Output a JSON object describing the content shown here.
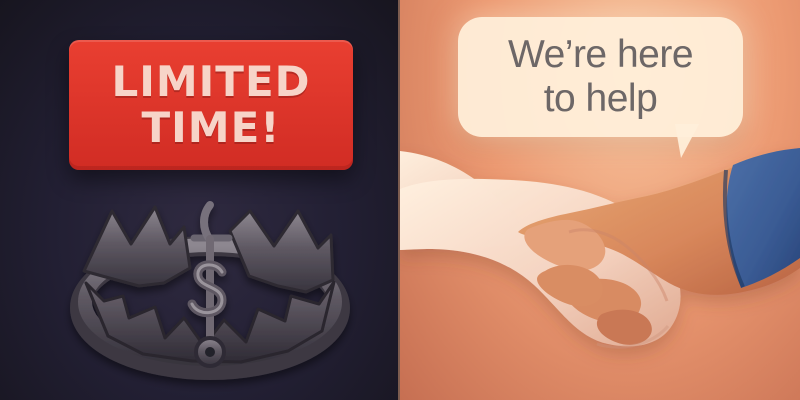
{
  "left_panel": {
    "sign": {
      "label": "LIMITED\nTIME!"
    },
    "icon": "bear-trap-dollar-icon"
  },
  "right_panel": {
    "speech_bubble": {
      "label": "We’re here\nto help"
    },
    "icon": "handshake-icon"
  },
  "colors": {
    "dark_background": "#221f33",
    "urgency_red": "#d93128",
    "warm_background": "#ec9a72",
    "bubble_cream": "#fff0db",
    "sleeve_blue": "#3f5c94"
  }
}
